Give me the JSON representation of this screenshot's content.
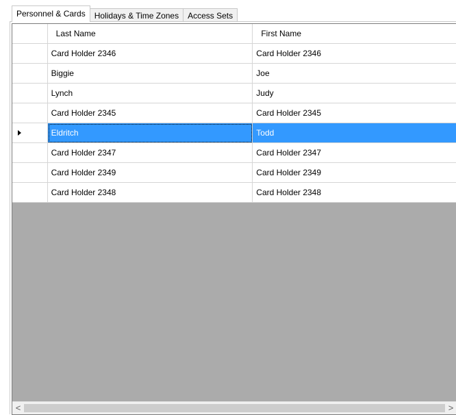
{
  "tabs": [
    {
      "label": "Personnel & Cards",
      "active": true
    },
    {
      "label": "Holidays & Time Zones",
      "active": false
    },
    {
      "label": "Access Sets",
      "active": false
    }
  ],
  "grid": {
    "columns": [
      "Last Name",
      "First Name"
    ],
    "rows": [
      {
        "last": "Card Holder 2346",
        "first": "Card Holder 2346"
      },
      {
        "last": "Biggie",
        "first": "Joe"
      },
      {
        "last": "Lynch",
        "first": "Judy"
      },
      {
        "last": "Card Holder 2345",
        "first": "Card Holder 2345"
      },
      {
        "last": "Eldritch",
        "first": "Todd"
      },
      {
        "last": "Card Holder 2347",
        "first": "Card Holder 2347"
      },
      {
        "last": "Card Holder 2349",
        "first": "Card Holder 2349"
      },
      {
        "last": "Card Holder 2348",
        "first": "Card Holder 2348"
      }
    ],
    "selected_row_index": 4
  },
  "scrollbar": {
    "left_icon": "chevron-left-icon",
    "right_icon": "chevron-right-icon",
    "left_glyph": "<",
    "right_glyph": ">"
  },
  "colors": {
    "selection": "#3399ff",
    "grid_background": "#ababab"
  }
}
